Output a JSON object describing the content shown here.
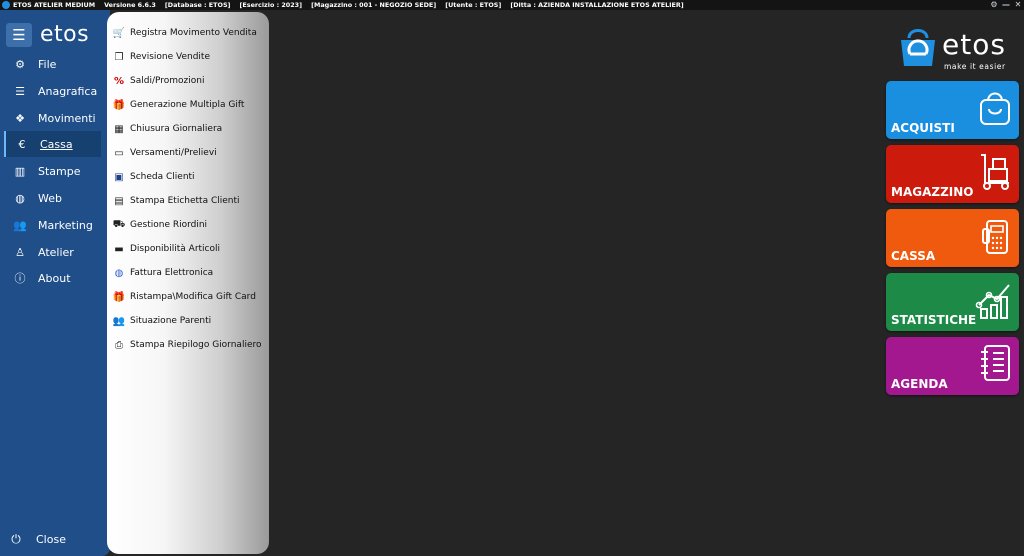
{
  "titlebar": {
    "app": "ETOS ATELIER MEDIUM",
    "version": "Versione 6.6.3",
    "database": "[Database : ETOS]",
    "esercizio": "[Esercizio : 2023]",
    "magazzino": "[Magazzino : 001 - NEGOZIO SEDE]",
    "utente": "[Utente : ETOS]",
    "ditta": "[Ditta : AZIENDA INSTALLAZIONE ETOS ATELIER]",
    "controls": [
      "⚙",
      "—",
      "✕"
    ]
  },
  "sidebar": {
    "logo": "etos",
    "hamburger": "☰",
    "items": [
      {
        "label": "File",
        "icon": "gear-icon",
        "glyph": "⚙"
      },
      {
        "label": "Anagrafica",
        "icon": "database-icon",
        "glyph": "☰"
      },
      {
        "label": "Movimenti",
        "icon": "cubes-icon",
        "glyph": "❖"
      },
      {
        "label": "Cassa",
        "icon": "euro-icon",
        "glyph": "€"
      },
      {
        "label": "Stampe",
        "icon": "chart-icon",
        "glyph": "▥"
      },
      {
        "label": "Web",
        "icon": "globe-icon",
        "glyph": "◍"
      },
      {
        "label": "Marketing",
        "icon": "users-icon",
        "glyph": "👥"
      },
      {
        "label": "Atelier",
        "icon": "person-icon",
        "glyph": "♙"
      },
      {
        "label": "About",
        "icon": "info-icon",
        "glyph": "ⓘ"
      }
    ],
    "active": "Cassa",
    "close_label": "Close",
    "close_glyph": "⏻"
  },
  "submenu": {
    "items": [
      {
        "label": "Registra Movimento Vendita",
        "icon": "cart-icon",
        "glyph": "🛒",
        "color": "#e87a1e"
      },
      {
        "label": "Revisione Vendite",
        "icon": "copy-icon",
        "glyph": "❐",
        "color": "#333333"
      },
      {
        "label": "Saldi/Promozioni",
        "icon": "percent-icon",
        "glyph": "%",
        "color": "#d40000"
      },
      {
        "label": "Generazione Multipla Gift",
        "icon": "gift-icon",
        "glyph": "🎁",
        "color": "#222222"
      },
      {
        "label": "Chiusura Giornaliera",
        "icon": "calculator-icon",
        "glyph": "▦",
        "color": "#222222"
      },
      {
        "label": "Versamenti/Prelievi",
        "icon": "money-icon",
        "glyph": "▭",
        "color": "#222222"
      },
      {
        "label": "Scheda Clienti",
        "icon": "contact-card-icon",
        "glyph": "▣",
        "color": "#1b3f8a"
      },
      {
        "label": "Stampa Etichetta Clienti",
        "icon": "id-card-icon",
        "glyph": "▤",
        "color": "#222222"
      },
      {
        "label": "Gestione Riordini",
        "icon": "truck-icon",
        "glyph": "⛟",
        "color": "#222222"
      },
      {
        "label": "Disponibilità Articoli",
        "icon": "archive-icon",
        "glyph": "▬",
        "color": "#222222"
      },
      {
        "label": "Fattura Elettronica",
        "icon": "globe-icon",
        "glyph": "◍",
        "color": "#2f5fd0"
      },
      {
        "label": "Ristampa\\Modifica Gift Card",
        "icon": "gift-icon",
        "glyph": "🎁",
        "color": "#222222"
      },
      {
        "label": "Situazione Parenti",
        "icon": "users-icon",
        "glyph": "👥",
        "color": "#222222"
      },
      {
        "label": "Stampa Riepilogo Giornaliero",
        "icon": "printer-icon",
        "glyph": "⎙",
        "color": "#222222"
      }
    ]
  },
  "brand": {
    "name": "etos",
    "tagline": "make it easier"
  },
  "tiles": [
    {
      "label": "ACQUISTI",
      "color": "#1a8fe0",
      "icon": "shopping-bag-icon"
    },
    {
      "label": "MAGAZZINO",
      "color": "#cc1a0d",
      "icon": "hand-truck-icon"
    },
    {
      "label": "CASSA",
      "color": "#f05a0f",
      "icon": "pos-terminal-icon"
    },
    {
      "label": "STATISTICHE",
      "color": "#1d8a48",
      "icon": "growth-chart-icon"
    },
    {
      "label": "AGENDA",
      "color": "#a3188f",
      "icon": "notebook-icon"
    }
  ]
}
